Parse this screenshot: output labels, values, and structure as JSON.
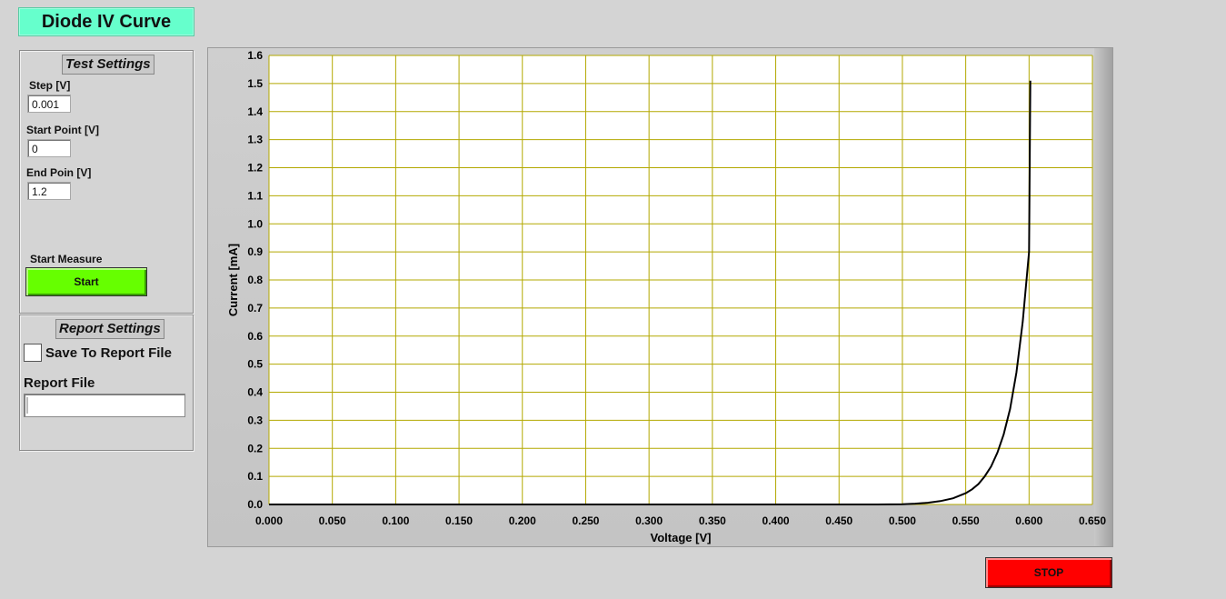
{
  "app": {
    "title": "Diode IV Curve"
  },
  "test_settings": {
    "title": "Test Settings",
    "step_label": "Step [V]",
    "step_value": "0.001",
    "start_label": "Start Point [V]",
    "start_value": "0",
    "end_label": "End Poin [V]",
    "end_value": "1.2",
    "measure_label": "Start Measure",
    "start_button": "Start"
  },
  "report_settings": {
    "title": "Report Settings",
    "save_label": "Save To Report File",
    "save_checked": false,
    "file_label": "Report File",
    "file_value": ""
  },
  "stop_button": "STOP",
  "colors": {
    "title_bg": "#66ffcc",
    "start_button": "#66ff00",
    "stop_button": "#ff0000",
    "grid": "#b3a800",
    "plot_bg": "#ffffff",
    "curve": "#000000"
  },
  "chart_data": {
    "type": "line",
    "xlabel": "Voltage  [V]",
    "ylabel": "Current  [mA]",
    "xlim": [
      0,
      0.65
    ],
    "ylim": [
      0,
      1.6
    ],
    "xticks": [
      "0.000",
      "0.050",
      "0.100",
      "0.150",
      "0.200",
      "0.250",
      "0.300",
      "0.350",
      "0.400",
      "0.450",
      "0.500",
      "0.550",
      "0.600",
      "0.650"
    ],
    "yticks": [
      "0.0",
      "0.1",
      "0.2",
      "0.3",
      "0.4",
      "0.5",
      "0.6",
      "0.7",
      "0.8",
      "0.9",
      "1.0",
      "1.1",
      "1.2",
      "1.3",
      "1.4",
      "1.5",
      "1.6"
    ],
    "grid": true,
    "series": [
      {
        "x": [
          0.0,
          0.1,
          0.2,
          0.3,
          0.4,
          0.45,
          0.48,
          0.5,
          0.51,
          0.52,
          0.53,
          0.54,
          0.55,
          0.555,
          0.56,
          0.565,
          0.57,
          0.575,
          0.58,
          0.585,
          0.59,
          0.595,
          0.6,
          0.601
        ],
        "y": [
          0.0,
          0.0,
          0.0,
          0.0,
          0.0,
          0.0,
          0.0,
          0.001,
          0.003,
          0.006,
          0.012,
          0.022,
          0.04,
          0.054,
          0.073,
          0.1,
          0.135,
          0.185,
          0.25,
          0.34,
          0.47,
          0.65,
          0.9,
          1.51
        ]
      }
    ]
  }
}
